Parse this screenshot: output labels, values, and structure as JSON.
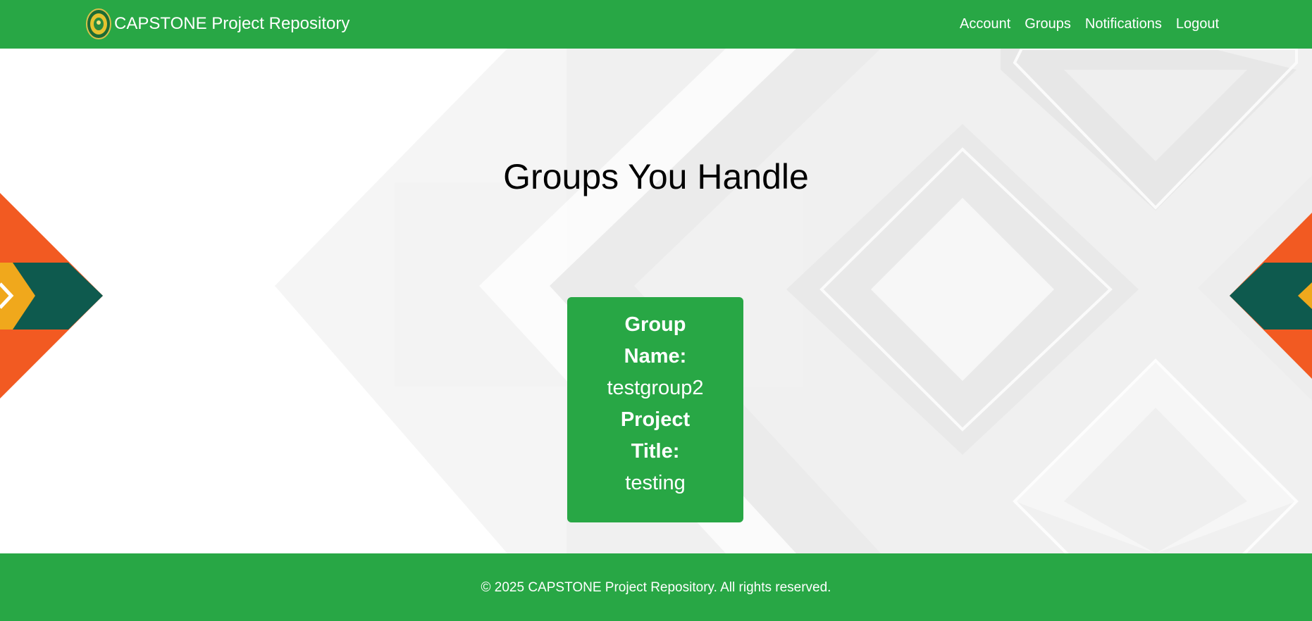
{
  "navbar": {
    "brand_title": "CAPSTONE Project Repository",
    "logo_icon": "university-seal-logo",
    "links": [
      "Account",
      "Groups",
      "Notifications",
      "Logout"
    ]
  },
  "main": {
    "title": "Groups You Handle",
    "groups": [
      {
        "name_label": "Group Name:",
        "name": "testgroup2",
        "project_label": "Project Title:",
        "project_title": "testing"
      }
    ]
  },
  "footer": {
    "copyright": "© 2025 CAPSTONE Project Repository. All rights reserved."
  },
  "colors": {
    "primary_green": "#28a745",
    "accent_orange": "#f25a22",
    "accent_yellow": "#f0a81c",
    "accent_teal": "#0e5a4e"
  }
}
